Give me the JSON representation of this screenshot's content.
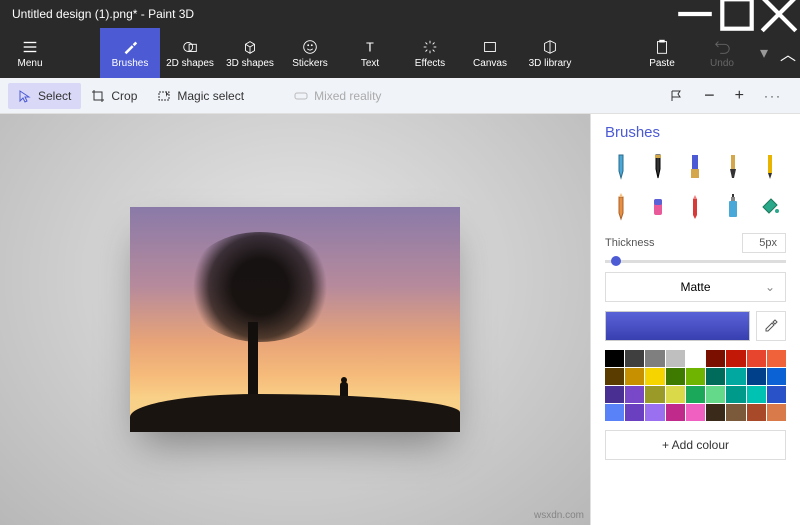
{
  "title": "Untitled design (1).png* - Paint 3D",
  "ribbon": {
    "menu": "Menu",
    "brushes": "Brushes",
    "shapes2d": "2D shapes",
    "shapes3d": "3D shapes",
    "stickers": "Stickers",
    "text": "Text",
    "effects": "Effects",
    "canvas": "Canvas",
    "lib3d": "3D library",
    "paste": "Paste",
    "undo": "Undo"
  },
  "toolbar": {
    "select": "Select",
    "crop": "Crop",
    "magic": "Magic select",
    "mixed": "Mixed reality"
  },
  "panel": {
    "title": "Brushes",
    "thickness_label": "Thickness",
    "thickness_value": "5px",
    "finish": "Matte",
    "add_colour": "+   Add colour"
  },
  "palette": [
    "#000000",
    "#3f3f3f",
    "#7f7f7f",
    "#bfbfbf",
    "#ffffff",
    "#7a0f00",
    "#c21807",
    "#e8452f",
    "#f0633a",
    "#5a3c00",
    "#c69000",
    "#f5d400",
    "#3e7a00",
    "#6fb400",
    "#006a5b",
    "#00a8a0",
    "#003f8a",
    "#0a62d4",
    "#4a2f92",
    "#7848c8",
    "#9a9a28",
    "#d9d94a",
    "#1ba85a",
    "#64d98a",
    "#009a8a",
    "#00c2b2",
    "#2a52c8",
    "#5a82f8",
    "#6a3fc0",
    "#9a6ff0",
    "#c02a8a",
    "#f060c0",
    "#3a2a1a",
    "#7a5a3a",
    "#a84a2a",
    "#d87a4a"
  ],
  "watermark": "wsxdn.com"
}
